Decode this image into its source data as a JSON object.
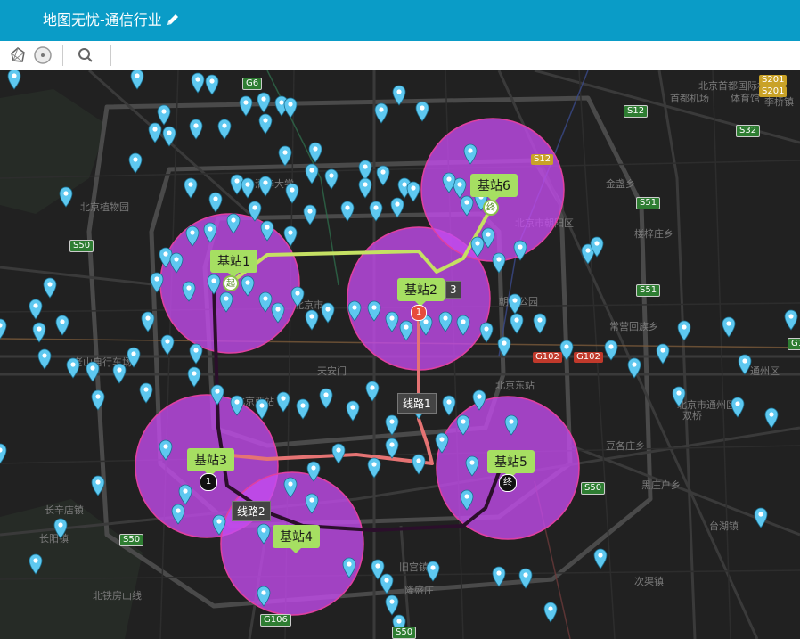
{
  "app": {
    "title": "地图无忧-通信行业",
    "edit_icon": "pencil-icon"
  },
  "toolbar": {
    "buttons": [
      {
        "name": "polygon-select-icon"
      },
      {
        "name": "circle-select-icon"
      },
      {
        "name": "search-icon"
      }
    ]
  },
  "map": {
    "place_labels": [
      "北京植物园",
      "清华大学",
      "北京首都国际机场",
      "首都机场",
      "体育馆",
      "李桥镇",
      "金盏乡",
      "楼梓庄乡",
      "北京市朝阳区",
      "朝阳公园",
      "常营回族乡",
      "豆各庄乡",
      "双桥",
      "黑庄户乡",
      "台湖镇",
      "次渠镇",
      "北京西站",
      "北京市",
      "北京东站",
      "天安门",
      "老山自行车场",
      "长辛店镇",
      "长阳镇",
      "旧宫镇",
      "隆盛庄",
      "北铁房山线",
      "北京市通州区",
      "通州区"
    ],
    "road_shields": [
      "G6",
      "S12",
      "S32",
      "S201",
      "S201",
      "S51",
      "S51",
      "S50",
      "S50",
      "S50",
      "S50",
      "G102",
      "G102",
      "G106",
      "G1",
      "S12"
    ],
    "stations": [
      {
        "name": "基站1",
        "marker": "起",
        "marker_type": "start"
      },
      {
        "name": "基站2",
        "marker": "1",
        "marker_type": "num"
      },
      {
        "name": "基站3",
        "marker": "1",
        "marker_type": "end"
      },
      {
        "name": "基站4",
        "marker": "",
        "marker_type": ""
      },
      {
        "name": "基站5",
        "marker": "终",
        "marker_type": "end"
      },
      {
        "name": "基站6",
        "marker": "终",
        "marker_type": "start"
      }
    ],
    "routes": [
      {
        "name": "线路1",
        "color": "#e57373"
      },
      {
        "name": "线路2",
        "color": "#2b0f2b"
      },
      {
        "name": "线路3",
        "color": "#c5e063"
      }
    ],
    "route_badge": "3",
    "colors": {
      "header": "#0a9cc7",
      "circle_fill": "#c54cf0",
      "pin": "#5ec8f0",
      "label": "#a6df62"
    }
  }
}
